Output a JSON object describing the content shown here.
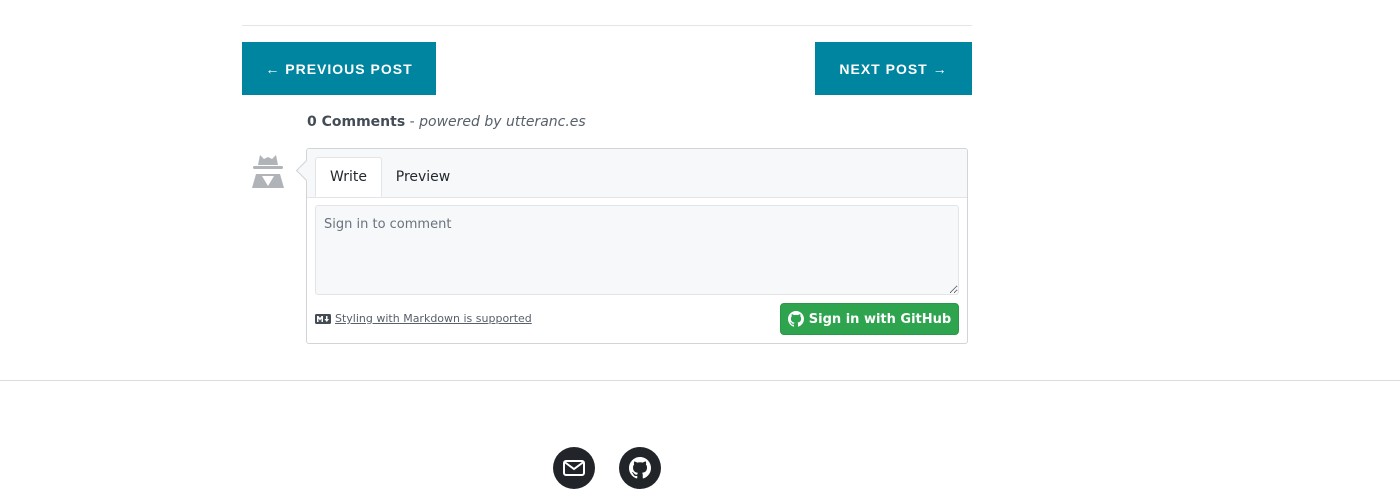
{
  "pager": {
    "previous_label": "← PREVIOUS POST",
    "next_label": "NEXT POST →"
  },
  "comments": {
    "count_label": "0 Comments",
    "separator": " - ",
    "powered_by": "powered by utteranc.es",
    "tabs": [
      {
        "label": "Write",
        "active": true
      },
      {
        "label": "Preview",
        "active": false
      }
    ],
    "textarea_placeholder": "Sign in to comment",
    "markdown_link": "Styling with Markdown is supported",
    "signin_label": "Sign in with GitHub"
  },
  "footer": {
    "icons": [
      "email-icon",
      "github-icon"
    ]
  },
  "colors": {
    "pager_bg": "#0085a1",
    "signin_bg": "#2ea44f",
    "social_bg": "#212529"
  }
}
